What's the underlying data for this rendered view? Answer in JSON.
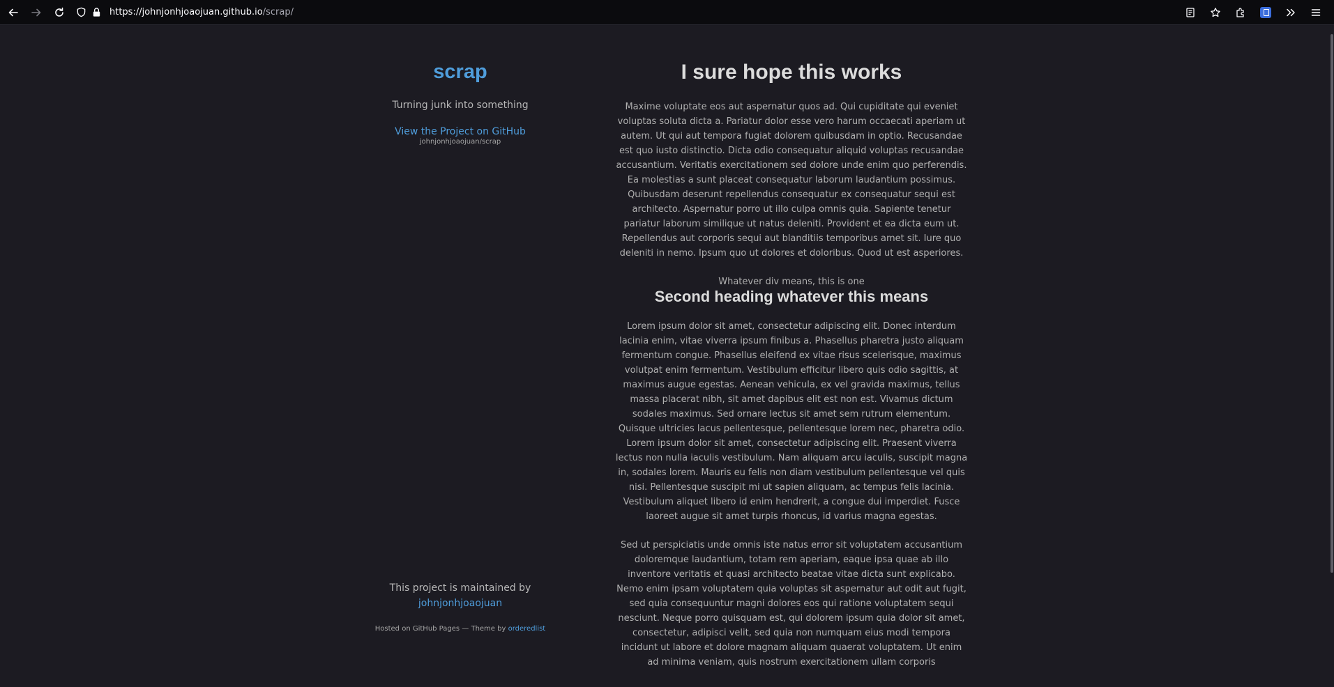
{
  "browser": {
    "url_host": "https://johnjonhjoaojuan.github.io",
    "url_path": "/scrap/",
    "icons": [
      "back-icon",
      "forward-icon",
      "reload-icon",
      "shield-icon",
      "lock-icon",
      "reader-view-icon",
      "bookmark-star-icon",
      "extensions-icon",
      "extension-badge-icon",
      "overflow-chevrons-icon",
      "menu-icon"
    ]
  },
  "sidebar": {
    "title": "scrap",
    "tagline": "Turning junk into something",
    "github_link": "View the Project on GitHub",
    "github_repo": "johnjonhjoaojuan/scrap",
    "maintained_by": "This project is maintained by",
    "maintainer": "johnjonhjoaojuan",
    "hosted_prefix": "Hosted on GitHub Pages — Theme by",
    "theme_author": "orderedlist"
  },
  "main": {
    "heading1": "I sure hope this works",
    "paragraph1": "Maxime voluptate eos aut aspernatur quos ad. Qui cupiditate qui eveniet voluptas soluta dicta a. Pariatur dolor esse vero harum occaecati aperiam ut autem. Ut qui aut tempora fugiat dolorem quibusdam in optio. Recusandae est quo iusto distinctio. Dicta odio consequatur aliquid voluptas recusandae accusantium. Veritatis exercitationem sed dolore unde enim quo perferendis. Ea molestias a sunt placeat consequatur laborum laudantium possimus. Quibusdam deserunt repellendus consequatur ex consequatur sequi est architecto. Aspernatur porro ut illo culpa omnis quia. Sapiente tenetur pariatur laborum similique ut natus deleniti. Provident et ea dicta eum ut. Repellendus aut corporis sequi aut blanditiis temporibus amet sit. Iure quo deleniti in nemo. Ipsum quo ut dolores et doloribus. Quod ut est asperiores.",
    "div_text": "Whatever div means, this is one",
    "heading2": "Second heading whatever this means",
    "paragraph2": "Lorem ipsum dolor sit amet, consectetur adipiscing elit. Donec interdum lacinia enim, vitae viverra ipsum finibus a. Phasellus pharetra justo aliquam fermentum congue. Phasellus eleifend ex vitae risus scelerisque, maximus volutpat enim fermentum. Vestibulum efficitur libero quis odio sagittis, at maximus augue egestas. Aenean vehicula, ex vel gravida maximus, tellus massa placerat nibh, sit amet dapibus elit est non est. Vivamus dictum sodales maximus. Sed ornare lectus sit amet sem rutrum elementum. Quisque ultricies lacus pellentesque, pellentesque lorem nec, pharetra odio. Lorem ipsum dolor sit amet, consectetur adipiscing elit. Praesent viverra lectus non nulla iaculis vestibulum. Nam aliquam arcu iaculis, suscipit magna in, sodales lorem. Mauris eu felis non diam vestibulum pellentesque vel quis nisi. Pellentesque suscipit mi ut sapien aliquam, ac tempus felis lacinia. Vestibulum aliquet libero id enim hendrerit, a congue dui imperdiet. Fusce laoreet augue sit amet turpis rhoncus, id varius magna egestas.",
    "paragraph3": "Sed ut perspiciatis unde omnis iste natus error sit voluptatem accusantium doloremque laudantium, totam rem aperiam, eaque ipsa quae ab illo inventore veritatis et quasi architecto beatae vitae dicta sunt explicabo. Nemo enim ipsam voluptatem quia voluptas sit aspernatur aut odit aut fugit, sed quia consequuntur magni dolores eos qui ratione voluptatem sequi nesciunt. Neque porro quisquam est, qui dolorem ipsum quia dolor sit amet, consectetur, adipisci velit, sed quia non numquam eius modi tempora incidunt ut labore et dolore magnam aliquam quaerat voluptatem. Ut enim ad minima veniam, quis nostrum exercitationem ullam corporis"
  },
  "colors": {
    "background": "#1c1b22",
    "toolbar": "#0b0b0e",
    "link": "#4f9ddb",
    "heading": "#dcdcdc",
    "body_text": "#b0b0b0"
  }
}
